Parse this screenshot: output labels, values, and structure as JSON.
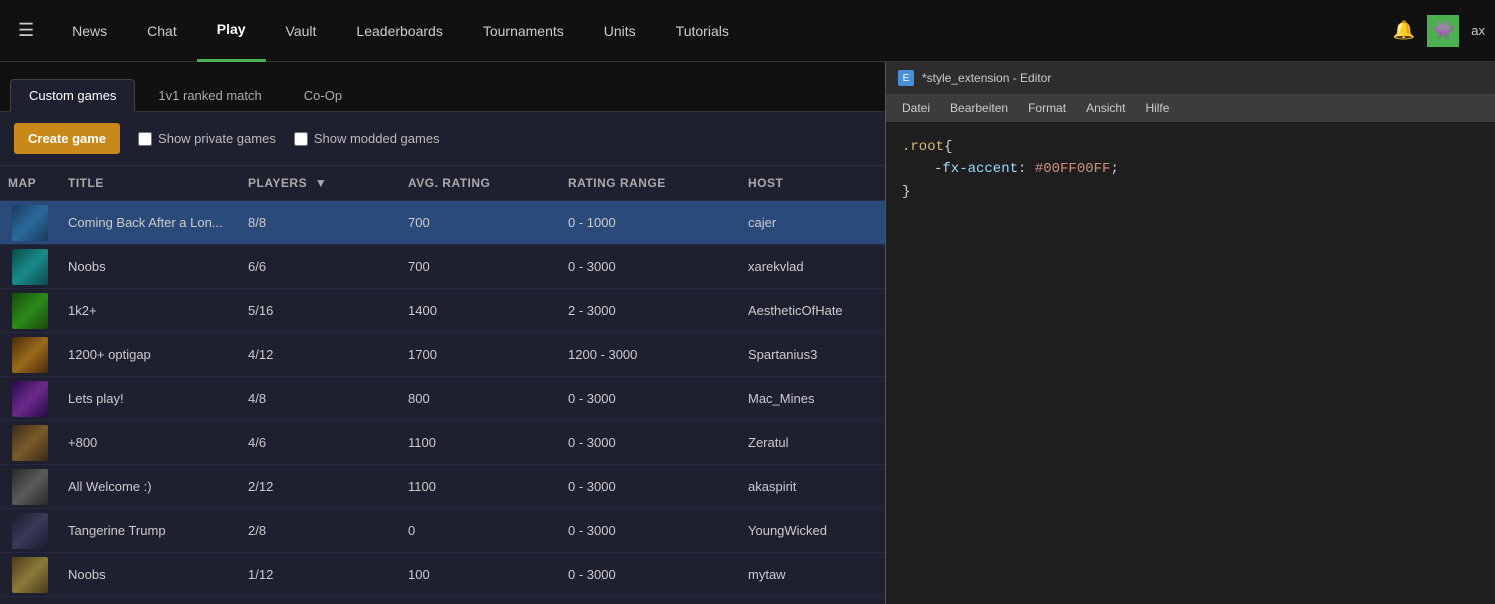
{
  "nav": {
    "hamburger": "☰",
    "items": [
      {
        "id": "news",
        "label": "News",
        "active": false
      },
      {
        "id": "chat",
        "label": "Chat",
        "active": false
      },
      {
        "id": "play",
        "label": "Play",
        "active": true
      },
      {
        "id": "vault",
        "label": "Vault",
        "active": false
      },
      {
        "id": "leaderboards",
        "label": "Leaderboards",
        "active": false
      },
      {
        "id": "tournaments",
        "label": "Tournaments",
        "active": false
      },
      {
        "id": "units",
        "label": "Units",
        "active": false
      },
      {
        "id": "tutorials",
        "label": "Tutorials",
        "active": false
      }
    ],
    "bell_label": "🔔",
    "avatar_label": "👾",
    "username": "ax"
  },
  "tabs": [
    {
      "id": "custom-games",
      "label": "Custom games",
      "active": true
    },
    {
      "id": "1v1-ranked",
      "label": "1v1 ranked match",
      "active": false
    },
    {
      "id": "coop",
      "label": "Co-Op",
      "active": false
    }
  ],
  "toolbar": {
    "create_game_label": "Create game",
    "show_private_label": "Show private games",
    "show_modded_label": "Show modded games"
  },
  "table": {
    "headers": [
      {
        "id": "map",
        "label": "Map"
      },
      {
        "id": "title",
        "label": "Title"
      },
      {
        "id": "players",
        "label": "Players",
        "sortable": true,
        "sort_arrow": "▼"
      },
      {
        "id": "avg-rating",
        "label": "Avg. Rating"
      },
      {
        "id": "rating-range",
        "label": "Rating Range"
      },
      {
        "id": "host",
        "label": "Host"
      }
    ],
    "rows": [
      {
        "id": 1,
        "map_color": "map-blue",
        "title": "Coming Back After a Lon...",
        "players": "8/8",
        "avg_rating": "700",
        "rating_range": "0 - 1000",
        "host": "cajer",
        "selected": true
      },
      {
        "id": 2,
        "map_color": "map-teal",
        "title": "Noobs",
        "players": "6/6",
        "avg_rating": "700",
        "rating_range": "0 - 3000",
        "host": "xarekvlad",
        "selected": false
      },
      {
        "id": 3,
        "map_color": "map-green",
        "title": "1k2+",
        "players": "5/16",
        "avg_rating": "1400",
        "rating_range": "2 - 3000",
        "host": "AestheticOfHate",
        "selected": false
      },
      {
        "id": 4,
        "map_color": "map-orange",
        "title": "1200+ optigap",
        "players": "4/12",
        "avg_rating": "1700",
        "rating_range": "1200 - 3000",
        "host": "Spartanius3",
        "selected": false
      },
      {
        "id": 5,
        "map_color": "map-purple",
        "title": "Lets play!",
        "players": "4/8",
        "avg_rating": "800",
        "rating_range": "0 - 3000",
        "host": "Mac_Mines",
        "selected": false
      },
      {
        "id": 6,
        "map_color": "map-brown",
        "title": "+800",
        "players": "4/6",
        "avg_rating": "1100",
        "rating_range": "0 - 3000",
        "host": "Zeratul",
        "selected": false
      },
      {
        "id": 7,
        "map_color": "map-gray",
        "title": "All Welcome :)",
        "players": "2/12",
        "avg_rating": "1100",
        "rating_range": "0 - 3000",
        "host": "akaspirit",
        "selected": false
      },
      {
        "id": 8,
        "map_color": "map-dark",
        "title": "Tangerine Trump",
        "players": "2/8",
        "avg_rating": "0",
        "rating_range": "0 - 3000",
        "host": "YoungWicked",
        "selected": false
      },
      {
        "id": 9,
        "map_color": "map-sand",
        "title": "Noobs",
        "players": "1/12",
        "avg_rating": "100",
        "rating_range": "0 - 3000",
        "host": "mytaw",
        "selected": false
      }
    ]
  },
  "editor": {
    "title": "*style_extension - Editor",
    "title_icon": "E",
    "menu_items": [
      "Datei",
      "Bearbeiten",
      "Format",
      "Ansicht",
      "Hilfe"
    ],
    "code": {
      "selector": ".root",
      "open_brace": "{",
      "property": "-fx-accent",
      "colon": ":",
      "value": " #00FF00FF",
      "semicolon": ";",
      "close_brace": "}"
    }
  }
}
